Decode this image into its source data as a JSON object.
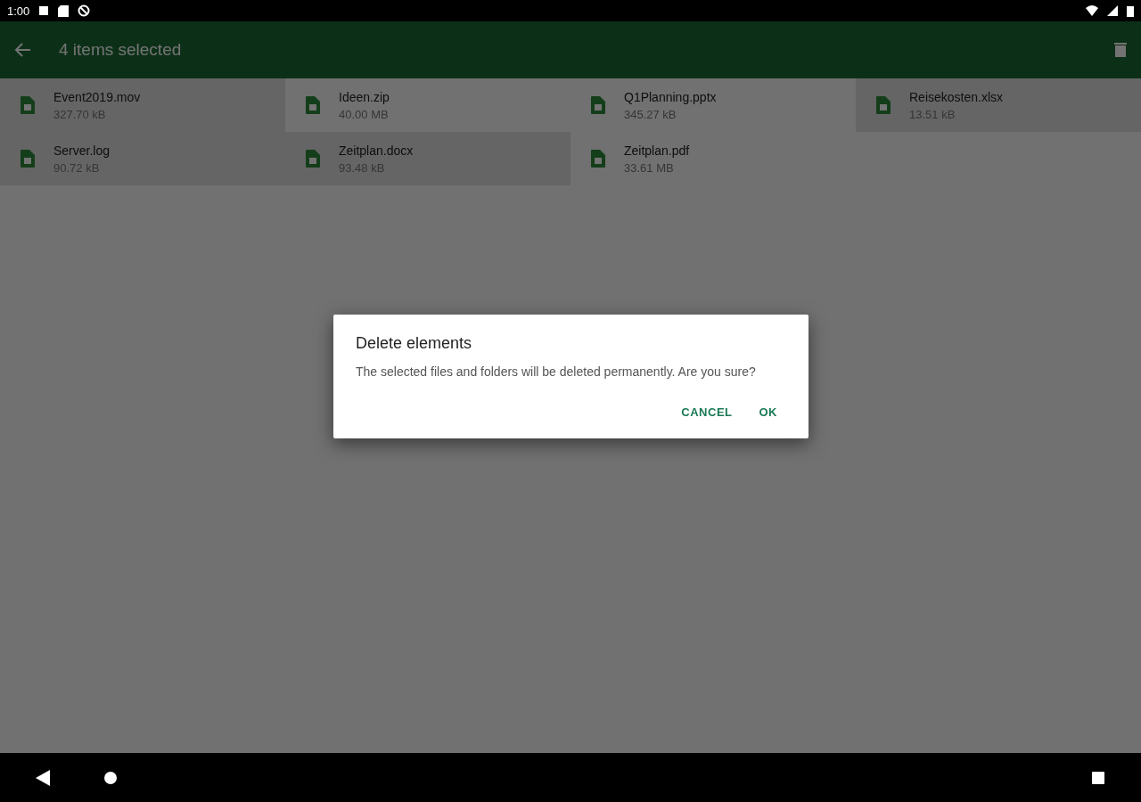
{
  "status_bar": {
    "time": "1:00"
  },
  "toolbar": {
    "title": "4 items selected"
  },
  "files": [
    {
      "name": "Event2019.mov",
      "size": "327.70 kB",
      "selected": true
    },
    {
      "name": "Ideen.zip",
      "size": "40.00 MB",
      "selected": false
    },
    {
      "name": "Q1Planning.pptx",
      "size": "345.27 kB",
      "selected": false
    },
    {
      "name": "Reisekosten.xlsx",
      "size": "13.51 kB",
      "selected": true
    },
    {
      "name": "Server.log",
      "size": "90.72 kB",
      "selected": true
    },
    {
      "name": "Zeitplan.docx",
      "size": "93.48 kB",
      "selected": true
    },
    {
      "name": "Zeitplan.pdf",
      "size": "33.61 MB",
      "selected": false
    }
  ],
  "dialog": {
    "title": "Delete elements",
    "message": "The selected files and folders will be deleted permanently. Are you sure?",
    "buttons": [
      "CANCEL",
      "OK"
    ]
  }
}
